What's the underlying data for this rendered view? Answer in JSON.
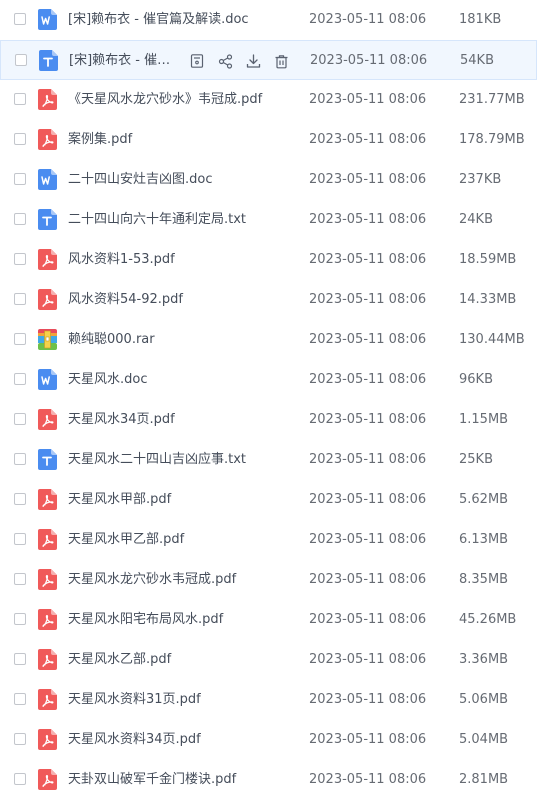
{
  "colors": {
    "word": "#4a8cf0",
    "txt": "#4a8cf0",
    "pdf": "#f05a5a",
    "hover_bg": "#f1f7fe",
    "action_icon": "#5a6270"
  },
  "hovered_row_index": 1,
  "row_actions": [
    {
      "icon": "file-info-icon"
    },
    {
      "icon": "share-icon"
    },
    {
      "icon": "download-icon"
    },
    {
      "icon": "trash-icon"
    }
  ],
  "files": [
    {
      "name": "[宋]赖布衣 - 催官篇及解读.doc",
      "date": "2023-05-11 08:06",
      "size": "181KB",
      "type": "doc",
      "icon": "word-doc-icon"
    },
    {
      "name": "[宋]赖布衣 - 催官篇及解读.txt",
      "date": "2023-05-11 08:06",
      "size": "54KB",
      "type": "txt",
      "icon": "text-file-icon"
    },
    {
      "name": "《天星风水龙穴砂水》韦冠成.pdf",
      "date": "2023-05-11 08:06",
      "size": "231.77MB",
      "type": "pdf",
      "icon": "pdf-file-icon"
    },
    {
      "name": "案例集.pdf",
      "date": "2023-05-11 08:06",
      "size": "178.79MB",
      "type": "pdf",
      "icon": "pdf-file-icon"
    },
    {
      "name": "二十四山安灶吉凶图.doc",
      "date": "2023-05-11 08:06",
      "size": "237KB",
      "type": "doc",
      "icon": "word-doc-icon"
    },
    {
      "name": "二十四山向六十年通利定局.txt",
      "date": "2023-05-11 08:06",
      "size": "24KB",
      "type": "txt",
      "icon": "text-file-icon"
    },
    {
      "name": "风水资料1-53.pdf",
      "date": "2023-05-11 08:06",
      "size": "18.59MB",
      "type": "pdf",
      "icon": "pdf-file-icon"
    },
    {
      "name": "风水资料54-92.pdf",
      "date": "2023-05-11 08:06",
      "size": "14.33MB",
      "type": "pdf",
      "icon": "pdf-file-icon"
    },
    {
      "name": "赖纯聪000.rar",
      "date": "2023-05-11 08:06",
      "size": "130.44MB",
      "type": "rar",
      "icon": "archive-file-icon"
    },
    {
      "name": "天星风水.doc",
      "date": "2023-05-11 08:06",
      "size": "96KB",
      "type": "doc",
      "icon": "word-doc-icon"
    },
    {
      "name": "天星风水34页.pdf",
      "date": "2023-05-11 08:06",
      "size": "1.15MB",
      "type": "pdf",
      "icon": "pdf-file-icon"
    },
    {
      "name": "天星风水二十四山吉凶应事.txt",
      "date": "2023-05-11 08:06",
      "size": "25KB",
      "type": "txt",
      "icon": "text-file-icon"
    },
    {
      "name": "天星风水甲部.pdf",
      "date": "2023-05-11 08:06",
      "size": "5.62MB",
      "type": "pdf",
      "icon": "pdf-file-icon"
    },
    {
      "name": "天星风水甲乙部.pdf",
      "date": "2023-05-11 08:06",
      "size": "6.13MB",
      "type": "pdf",
      "icon": "pdf-file-icon"
    },
    {
      "name": "天星风水龙穴砂水韦冠成.pdf",
      "date": "2023-05-11 08:06",
      "size": "8.35MB",
      "type": "pdf",
      "icon": "pdf-file-icon"
    },
    {
      "name": "天星风水阳宅布局风水.pdf",
      "date": "2023-05-11 08:06",
      "size": "45.26MB",
      "type": "pdf",
      "icon": "pdf-file-icon"
    },
    {
      "name": "天星风水乙部.pdf",
      "date": "2023-05-11 08:06",
      "size": "3.36MB",
      "type": "pdf",
      "icon": "pdf-file-icon"
    },
    {
      "name": "天星风水资料31页.pdf",
      "date": "2023-05-11 08:06",
      "size": "5.06MB",
      "type": "pdf",
      "icon": "pdf-file-icon"
    },
    {
      "name": "天星风水资料34页.pdf",
      "date": "2023-05-11 08:06",
      "size": "5.04MB",
      "type": "pdf",
      "icon": "pdf-file-icon"
    },
    {
      "name": "天卦双山破军千金门楼诀.pdf",
      "date": "2023-05-11 08:06",
      "size": "2.81MB",
      "type": "pdf",
      "icon": "pdf-file-icon"
    }
  ]
}
